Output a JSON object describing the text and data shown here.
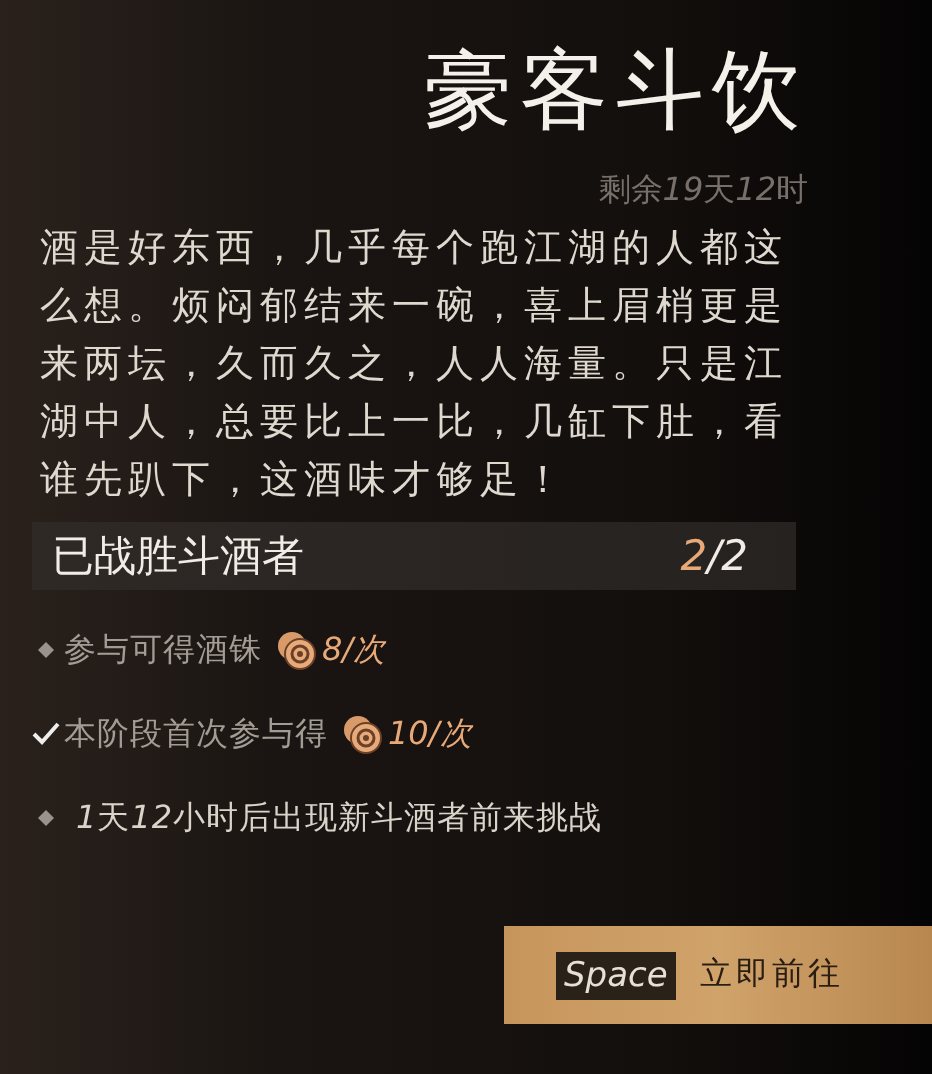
{
  "title": "豪客斗饮",
  "time_left": "剩余19天12时",
  "description": "酒是好东西，几乎每个跑江湖的人都这么想。烦闷郁结来一碗，喜上眉梢更是来两坛，久而久之，人人海量。只是江湖中人，总要比上一比，几缸下肚，看谁先趴下，这酒味才够足！",
  "progress": {
    "label": "已战胜斗酒者",
    "done": "2",
    "total": "/2"
  },
  "items": [
    {
      "kind": "reward",
      "completed": false,
      "text": "参与可得酒铢",
      "amount": "8/次"
    },
    {
      "kind": "reward",
      "completed": true,
      "text": "本阶段首次参与得",
      "amount": "10/次"
    },
    {
      "kind": "note",
      "completed": false,
      "text": "1天12小时后出现新斗酒者前来挑战"
    }
  ],
  "action": {
    "key": "Space",
    "label": "立即前往"
  }
}
